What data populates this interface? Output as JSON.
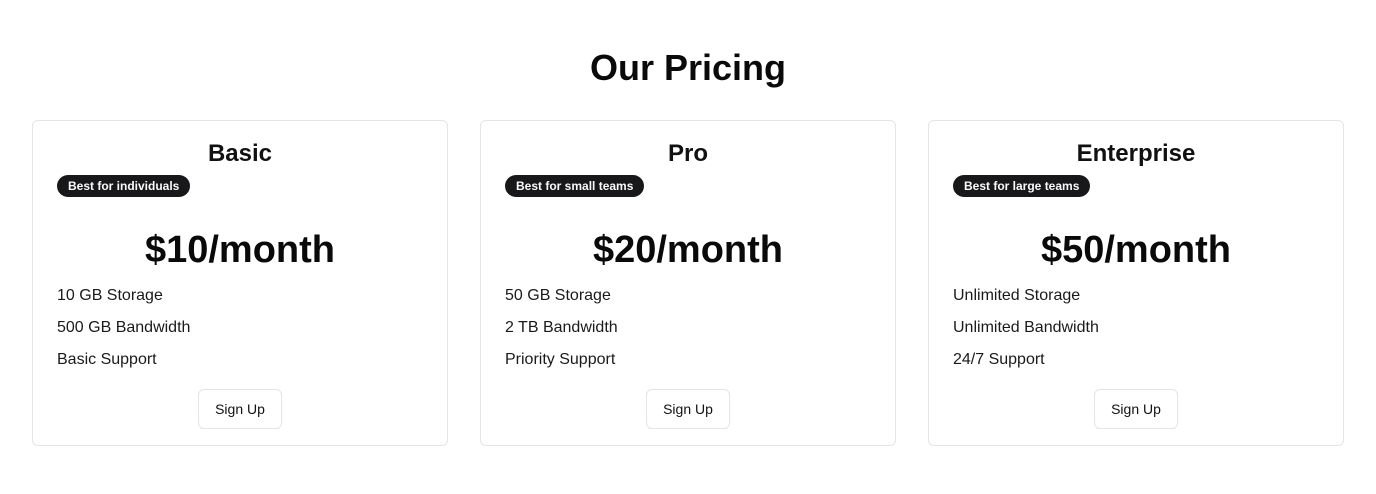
{
  "page": {
    "title": "Our Pricing"
  },
  "colors": {
    "background": "#ffffff",
    "text": "#0a0a0a",
    "badge_background": "#18181b",
    "badge_text": "#fafafa",
    "border": "#e4e4e7"
  },
  "plans": [
    {
      "name": "Basic",
      "badge": "Best for individuals",
      "price": "$10/month",
      "features": [
        "10 GB Storage",
        "500 GB Bandwidth",
        "Basic Support"
      ],
      "cta_label": "Sign Up"
    },
    {
      "name": "Pro",
      "badge": "Best for small teams",
      "price": "$20/month",
      "features": [
        "50 GB Storage",
        "2 TB Bandwidth",
        "Priority Support"
      ],
      "cta_label": "Sign Up"
    },
    {
      "name": "Enterprise",
      "badge": "Best for large teams",
      "price": "$50/month",
      "features": [
        "Unlimited Storage",
        "Unlimited Bandwidth",
        "24/7 Support"
      ],
      "cta_label": "Sign Up"
    }
  ]
}
